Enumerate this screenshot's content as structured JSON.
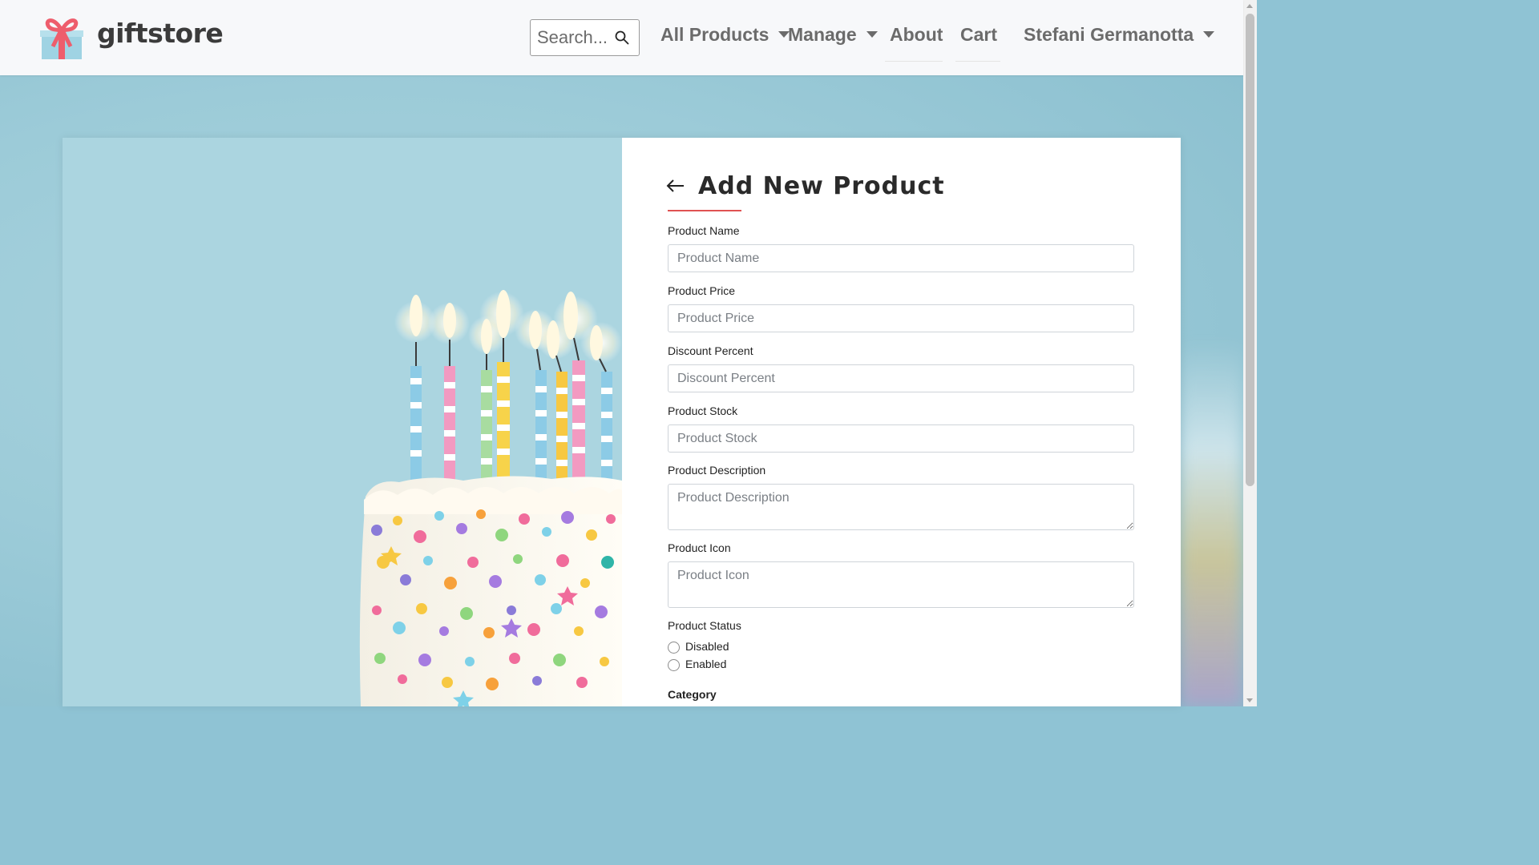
{
  "navbar": {
    "brand": "giftstore",
    "search": {
      "placeholder": "Search..."
    },
    "links": [
      {
        "label": "All Products",
        "dropdown": true
      },
      {
        "label": "Manage",
        "dropdown": true
      },
      {
        "label": "About",
        "dropdown": false
      },
      {
        "label": "Cart",
        "dropdown": false
      }
    ],
    "user": {
      "label": "Stefani Germanotta",
      "dropdown": true
    }
  },
  "icons": {
    "logo": "gift-box-icon",
    "search": "magnifier-icon",
    "back": "arrow-left-icon",
    "caret": "caret-down-icon"
  },
  "colors": {
    "accent_rule": "#e05252",
    "logo_box": "#9fd3e3",
    "logo_ribbon": "#ee5d6c",
    "brand_text": "#3b3b3b",
    "nav_text": "#6b6b6b"
  },
  "form": {
    "title": "Add New Product",
    "fields": [
      {
        "label": "Product Name",
        "placeholder": "Product Name",
        "value": ""
      },
      {
        "label": "Product Price",
        "placeholder": "Product Price",
        "value": ""
      },
      {
        "label": "Discount Percent",
        "placeholder": "Discount Percent",
        "value": ""
      },
      {
        "label": "Product Stock",
        "placeholder": "Product Stock",
        "value": ""
      }
    ],
    "description": {
      "label": "Product Description",
      "placeholder": "Product Description",
      "value": ""
    },
    "icon": {
      "label": "Product Icon",
      "placeholder": "Product Icon",
      "value": ""
    },
    "status": {
      "label": "Product Status",
      "options": [
        "Disabled",
        "Enabled"
      ],
      "selected": null
    },
    "category": {
      "label": "Category"
    }
  }
}
